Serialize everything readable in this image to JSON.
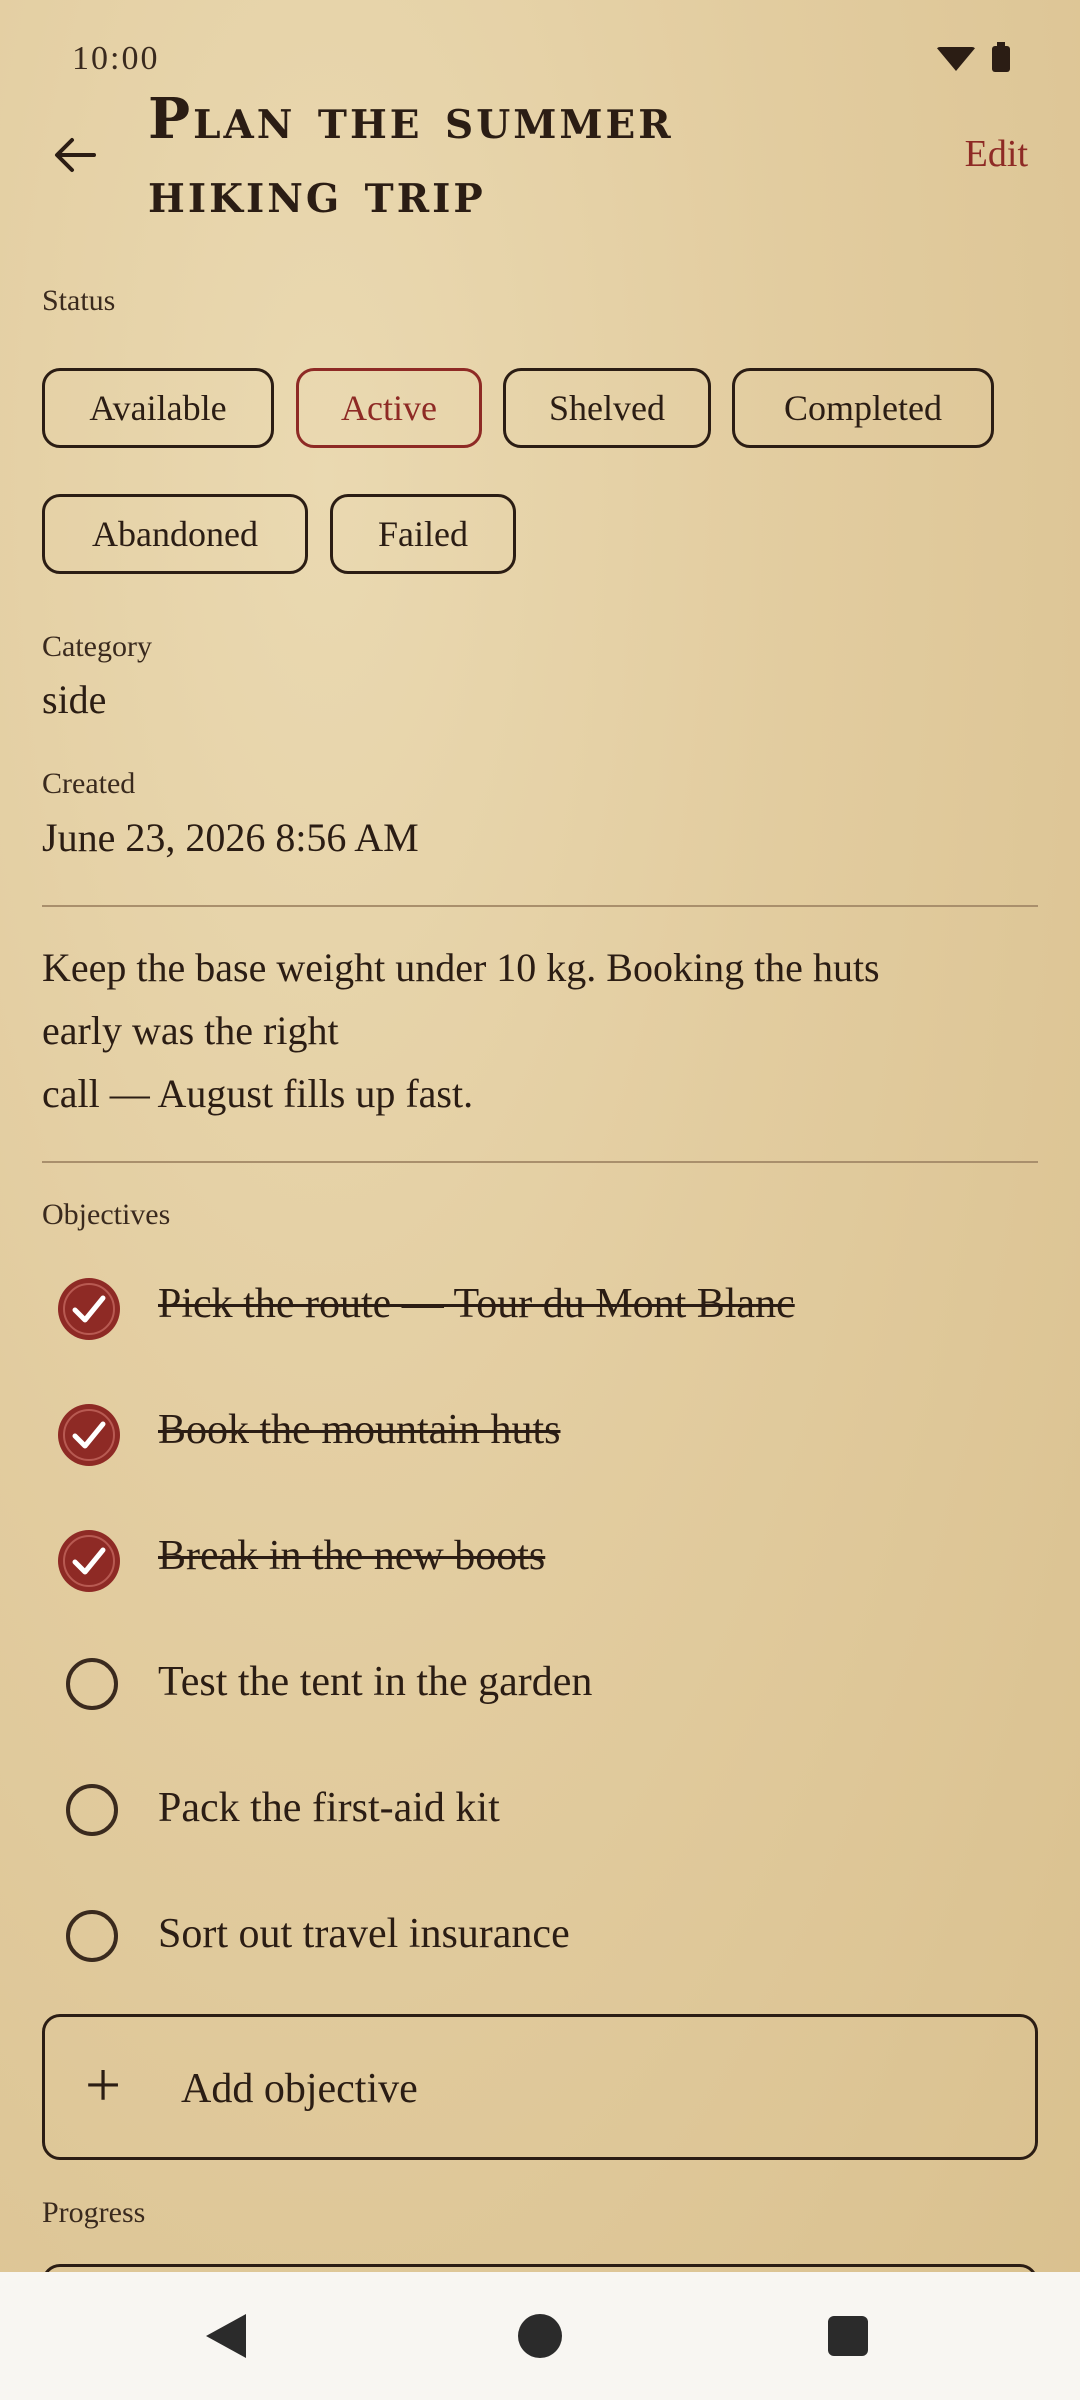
{
  "status_bar": {
    "time": "10:00"
  },
  "header": {
    "title": "Plan the summer hiking trip",
    "edit_label": "Edit"
  },
  "status": {
    "label": "Status",
    "options": [
      "Available",
      "Active",
      "Shelved",
      "Completed",
      "Abandoned",
      "Failed"
    ],
    "selected": "Active"
  },
  "category": {
    "label": "Category",
    "value": "side"
  },
  "created": {
    "label": "Created",
    "value": "June 23, 2026 8:56 AM"
  },
  "notes": {
    "line1": "Keep the base weight under 10 kg. Booking the huts",
    "line2": "early was the right",
    "line3": "call — August fills up fast."
  },
  "objectives": {
    "label": "Objectives",
    "items": [
      {
        "text": "Pick the route — Tour du Mont Blanc",
        "done": true
      },
      {
        "text": "Book the mountain huts",
        "done": true
      },
      {
        "text": "Break in the new boots",
        "done": true
      },
      {
        "text": "Test the tent in the garden",
        "done": false
      },
      {
        "text": "Pack the first-aid kit",
        "done": false
      },
      {
        "text": "Sort out travel insurance",
        "done": false
      }
    ],
    "add_label": "Add objective"
  },
  "progress": {
    "label": "Progress"
  },
  "colors": {
    "accent": "#8e2a25",
    "ink": "#2b1d14",
    "parchment": "#e2cc9f"
  },
  "icons": {
    "back": "arrow-left-icon",
    "check": "wax-seal-check-icon",
    "add": "plus-icon"
  }
}
